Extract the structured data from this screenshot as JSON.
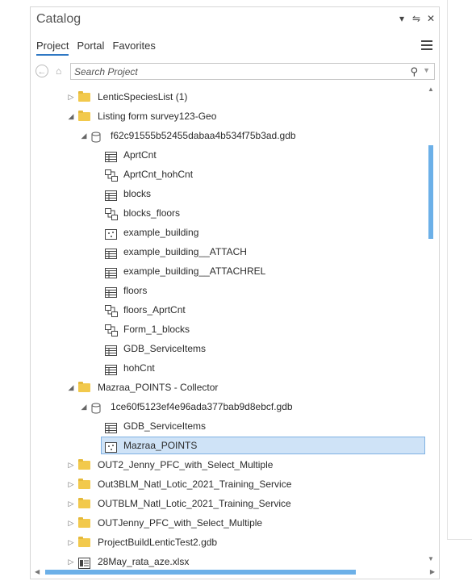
{
  "catalog": {
    "title": "Catalog",
    "title_icons": [
      "chevron-down-icon",
      "pin-icon",
      "close-icon"
    ],
    "tabs": [
      {
        "label": "Project",
        "active": true
      },
      {
        "label": "Portal",
        "active": false
      },
      {
        "label": "Favorites",
        "active": false
      }
    ],
    "search": {
      "placeholder": "Search Project",
      "value": ""
    },
    "accent_color": "#2f78c4",
    "folder_color": "#f2c94c",
    "selection_color": "#cfe3f7"
  },
  "tree": [
    {
      "label": "LenticSpeciesList (1)",
      "icon": "folder-icon",
      "level": 0,
      "expander": "collapsed"
    },
    {
      "label": "Listing form survey123-Geo",
      "icon": "folder-icon",
      "level": 0,
      "expander": "expanded"
    },
    {
      "label": "f62c91555b52455dabaa4b534f75b3ad.gdb",
      "icon": "database-icon",
      "level": 1,
      "expander": "expanded"
    },
    {
      "label": "AprtCnt",
      "icon": "table-icon",
      "level": 2,
      "expander": "none"
    },
    {
      "label": "AprtCnt_hohCnt",
      "icon": "relationship-class-icon",
      "level": 2,
      "expander": "none"
    },
    {
      "label": "blocks",
      "icon": "table-icon",
      "level": 2,
      "expander": "none"
    },
    {
      "label": "blocks_floors",
      "icon": "relationship-class-icon",
      "level": 2,
      "expander": "none"
    },
    {
      "label": "example_building",
      "icon": "point-feature-class-icon",
      "level": 2,
      "expander": "none"
    },
    {
      "label": "example_building__ATTACH",
      "icon": "table-icon",
      "level": 2,
      "expander": "none"
    },
    {
      "label": "example_building__ATTACHREL",
      "icon": "table-icon",
      "level": 2,
      "expander": "none"
    },
    {
      "label": "floors",
      "icon": "table-icon",
      "level": 2,
      "expander": "none"
    },
    {
      "label": "floors_AprtCnt",
      "icon": "relationship-class-icon",
      "level": 2,
      "expander": "none"
    },
    {
      "label": "Form_1_blocks",
      "icon": "relationship-class-icon",
      "level": 2,
      "expander": "none"
    },
    {
      "label": "GDB_ServiceItems",
      "icon": "table-icon",
      "level": 2,
      "expander": "none"
    },
    {
      "label": "hohCnt",
      "icon": "table-icon",
      "level": 2,
      "expander": "none"
    },
    {
      "label": "Mazraa_POINTS - Collector",
      "icon": "folder-icon",
      "level": 0,
      "expander": "expanded"
    },
    {
      "label": "1ce60f5123ef4e96ada377bab9d8ebcf.gdb",
      "icon": "database-icon",
      "level": 1,
      "expander": "expanded"
    },
    {
      "label": "GDB_ServiceItems",
      "icon": "table-icon",
      "level": 2,
      "expander": "none"
    },
    {
      "label": "Mazraa_POINTS",
      "icon": "point-feature-class-icon",
      "level": 2,
      "expander": "none",
      "selected": true
    },
    {
      "label": "OUT2_Jenny_PFC_with_Select_Multiple",
      "icon": "folder-icon",
      "level": 0,
      "expander": "collapsed"
    },
    {
      "label": "Out3BLM_Natl_Lotic_2021_Training_Service",
      "icon": "folder-icon",
      "level": 0,
      "expander": "collapsed"
    },
    {
      "label": "OUTBLM_Natl_Lotic_2021_Training_Service",
      "icon": "folder-icon",
      "level": 0,
      "expander": "collapsed"
    },
    {
      "label": "OUTJenny_PFC_with_Select_Multiple",
      "icon": "folder-icon",
      "level": 0,
      "expander": "collapsed"
    },
    {
      "label": "ProjectBuildLenticTest2.gdb",
      "icon": "folder-icon",
      "level": 0,
      "expander": "collapsed"
    },
    {
      "label": "28May_rata_aze.xlsx",
      "icon": "spreadsheet-icon",
      "level": 0,
      "expander": "collapsed"
    }
  ]
}
